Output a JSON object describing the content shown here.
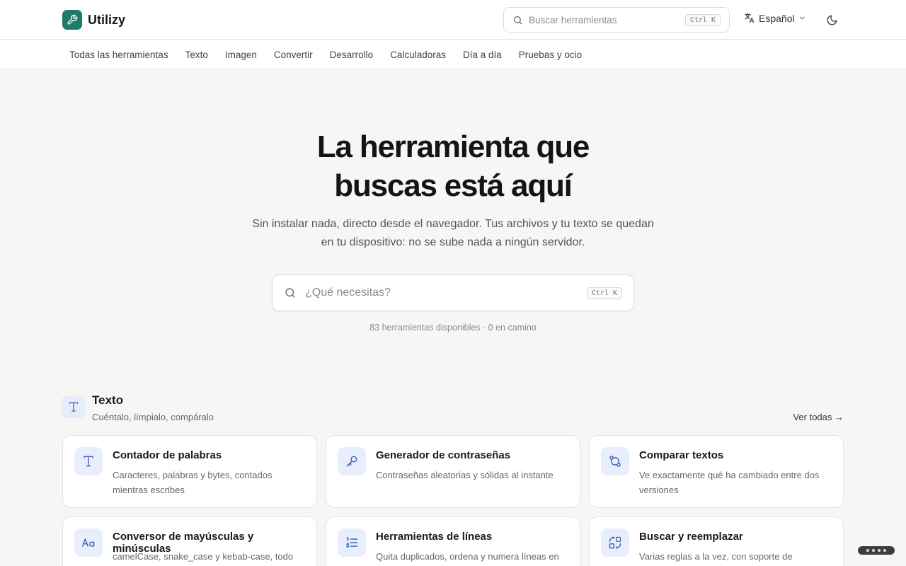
{
  "brand": {
    "name": "Utilizy",
    "icon": "wrench-icon",
    "color": "#1f7a6c"
  },
  "header": {
    "search_placeholder": "Buscar herramientas",
    "search_shortcut": "Ctrl K",
    "language": "Español",
    "theme_icon": "moon-icon"
  },
  "nav": {
    "items": [
      "Todas las herramientas",
      "Texto",
      "Imagen",
      "Convertir",
      "Desarrollo",
      "Calculadoras",
      "Día a día",
      "Pruebas y ocio"
    ]
  },
  "hero": {
    "title_line1": "La herramienta que",
    "title_line2": "buscas está aquí",
    "subtitle_line1": "Sin instalar nada, directo desde el navegador. Tus archivos y tu texto se quedan",
    "subtitle_line2": "en tu dispositivo: no se sube nada a ningún servidor.",
    "search_placeholder": "¿Qué necesitas?",
    "search_shortcut": "Ctrl K",
    "stats": "83 herramientas disponibles · 0 en camino"
  },
  "section": {
    "title": "Texto",
    "description": "Cuéntalo, límpialo, compáralo",
    "see_all": "Ver todas →",
    "icon": "text-t-icon",
    "accent": "#3b62b8",
    "tools": [
      {
        "title": "Contador de palabras",
        "description": "Caracteres, palabras y bytes, contados mientras escribes",
        "icon": "text-t-icon"
      },
      {
        "title": "Generador de contraseñas",
        "description": "Contraseñas aleatorias y sólidas al instante",
        "icon": "key-icon"
      },
      {
        "title": "Comparar textos",
        "description": "Ve exactamente qué ha cambiado entre dos versiones",
        "icon": "git-compare-icon"
      },
      {
        "title": "Conversor de mayúsculas y minúsculas",
        "description": "camelCase, snake_case y kebab-case, todo a",
        "icon": "case-aa-icon"
      },
      {
        "title": "Herramientas de líneas",
        "description": "Quita duplicados, ordena y numera líneas en",
        "icon": "numbered-list-icon"
      },
      {
        "title": "Buscar y reemplazar",
        "description": "Varias reglas a la vez, con soporte de",
        "icon": "replace-icon"
      }
    ]
  }
}
